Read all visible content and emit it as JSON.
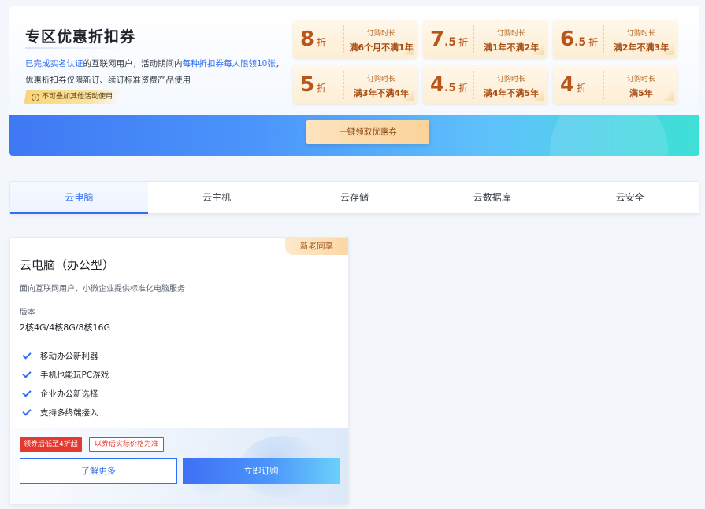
{
  "promo": {
    "title": "专区优惠折扣券",
    "desc_part1": "已完成实名认证",
    "desc_part2": "的互联网用户，活动期间内",
    "desc_part3": "每种折扣券每人限领10张",
    "desc_part4": "，",
    "desc_line2": "优惠折扣券仅限新订、续订标准资费产品使用",
    "note": "不可叠加其他活动使用",
    "claim_button": "一键领取优惠券",
    "coupons": [
      {
        "num": "8",
        "small": "",
        "unit": "折",
        "label": "订购时长",
        "value": "满6个月不满1年"
      },
      {
        "num": "7",
        "small": ".5",
        "unit": "折",
        "label": "订购时长",
        "value": "满1年不满2年"
      },
      {
        "num": "6",
        "small": ".5",
        "unit": "折",
        "label": "订购时长",
        "value": "满2年不满3年"
      },
      {
        "num": "5",
        "small": "",
        "unit": "折",
        "label": "订购时长",
        "value": "满3年不满4年"
      },
      {
        "num": "4",
        "small": ".5",
        "unit": "折",
        "label": "订购时长",
        "value": "满4年不满5年"
      },
      {
        "num": "4",
        "small": "",
        "unit": "折",
        "label": "订购时长",
        "value": "满5年"
      }
    ]
  },
  "tabs": [
    "云电脑",
    "云主机",
    "云存储",
    "云数据库",
    "云安全"
  ],
  "active_tab": "云电脑",
  "card": {
    "badge": "新老同享",
    "title": "云电脑（办公型）",
    "subtitle": "面向互联网用户、小微企业提供标准化电脑服务",
    "version_label": "版本",
    "version_value": "2核4G/4核8G/8核16G",
    "features": [
      "移动办公新利器",
      "手机也能玩PC游戏",
      "企业办公新选择",
      "支持多终端接入"
    ],
    "tag_discount": "领券后低至4折起",
    "tag_note": "以券后实际价格为准",
    "btn_more": "了解更多",
    "btn_buy": "立即订购"
  },
  "colors": {
    "accent": "#2f6ef6",
    "coupon_text": "#b8551a",
    "red": "#e5382e"
  }
}
